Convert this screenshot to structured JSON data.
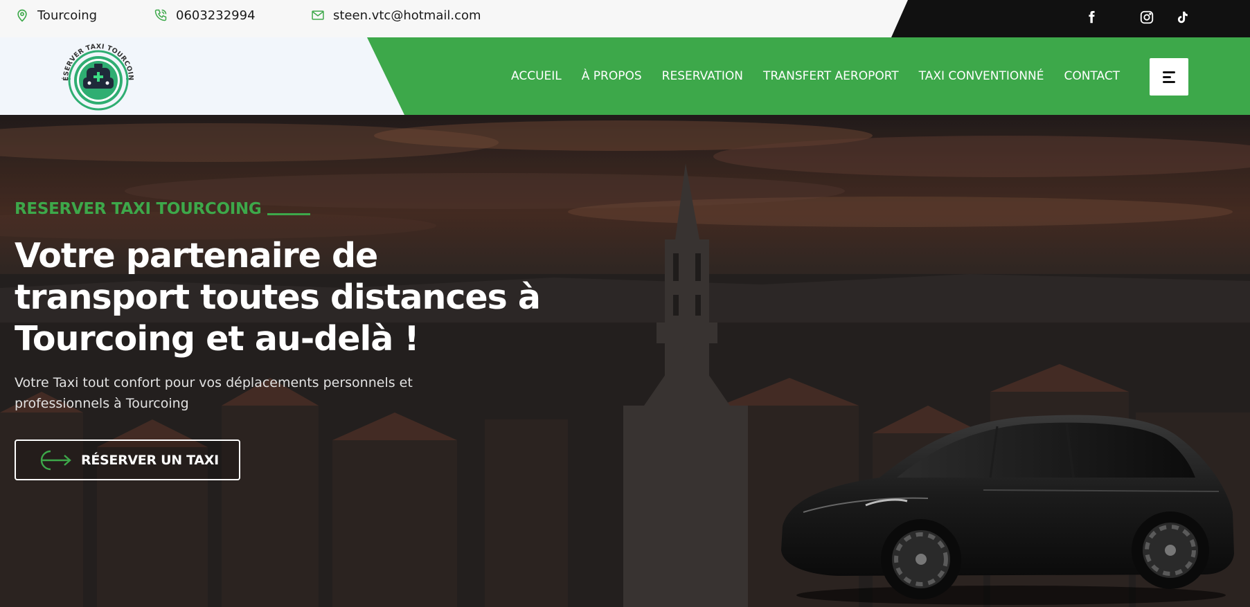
{
  "topbar": {
    "location": "Tourcoing",
    "phone": "0603232994",
    "email": "steen.vtc@hotmail.com",
    "social": [
      {
        "name": "facebook-icon"
      },
      {
        "name": "instagram-icon"
      },
      {
        "name": "tiktok-icon"
      }
    ]
  },
  "logo": {
    "text": "RÉSERVER TAXI TOURCOING"
  },
  "nav": {
    "items": [
      {
        "label": "ACCUEIL"
      },
      {
        "label": "À PROPOS"
      },
      {
        "label": "RESERVATION"
      },
      {
        "label": "TRANSFERT AEROPORT"
      },
      {
        "label": "TAXI CONVENTIONNÉ"
      },
      {
        "label": "CONTACT"
      }
    ]
  },
  "hero": {
    "eyebrow": "RESERVER TAXI TOURCOING",
    "headline_line1": "Votre partenaire de",
    "headline_line2": "transport toutes distances à",
    "headline_line3": "Tourcoing et au-delà !",
    "subtitle_line1": "Votre Taxi tout confort pour vos déplacements personnels et",
    "subtitle_line2": "professionnels à Tourcoing",
    "cta_label": "RÉSERVER UN TAXI"
  },
  "colors": {
    "brand_green": "#3da84a",
    "topbar_dark": "#111111",
    "topbar_light": "#f7f7f7",
    "nav_light": "#f2f6fb"
  }
}
